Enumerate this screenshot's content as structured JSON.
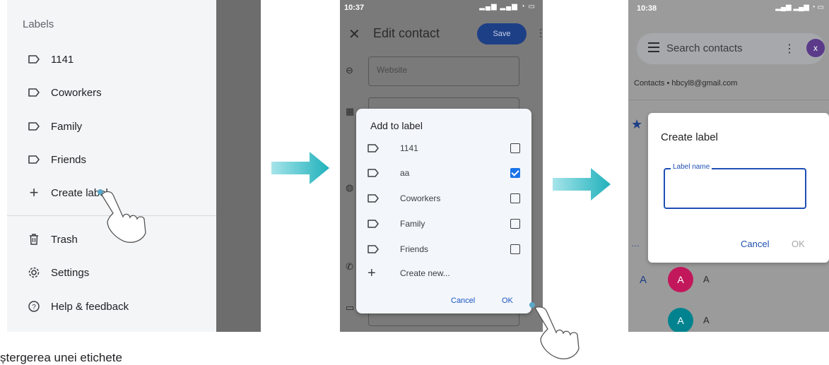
{
  "panel1": {
    "section_header": "Labels",
    "labels": [
      "1141",
      "Coworkers",
      "Family",
      "Friends"
    ],
    "create_label": "Create label",
    "trash": "Trash",
    "settings": "Settings",
    "help": "Help & feedback"
  },
  "panel2": {
    "time": "10:37",
    "status_icons": "▂▄▆ ▂▄▆ ◔ ▭",
    "title": "Edit contact",
    "save": "Save",
    "website_placeholder": "Website",
    "dialog_title": "Add to label",
    "labels": [
      {
        "name": "1141",
        "checked": false
      },
      {
        "name": "aa",
        "checked": true
      },
      {
        "name": "Coworkers",
        "checked": false
      },
      {
        "name": "Family",
        "checked": false
      },
      {
        "name": "Friends",
        "checked": false
      }
    ],
    "create_new": "Create new...",
    "cancel": "Cancel",
    "ok": "OK"
  },
  "panel3": {
    "time": "10:38",
    "status_icons": "▂▄▆ ▂▄▆ ◔ ▭",
    "search_placeholder": "Search contacts",
    "avatar_letter": "x",
    "account": "Contacts • hbcyl8@gmail.com",
    "dialog_title": "Create label",
    "field_label": "Label name",
    "cancel": "Cancel",
    "ok": "OK",
    "section_letter": "A",
    "contacts": [
      {
        "initial": "A",
        "name": "A",
        "color": "#c2185b"
      },
      {
        "initial": "A",
        "name": "A",
        "color": "#00838f"
      }
    ]
  },
  "colors": {
    "arrow": "#3bbcc4",
    "accent_blue": "#1a73e8",
    "save_button": "#1d3f86"
  },
  "caption": "ștergerea unei etichete"
}
